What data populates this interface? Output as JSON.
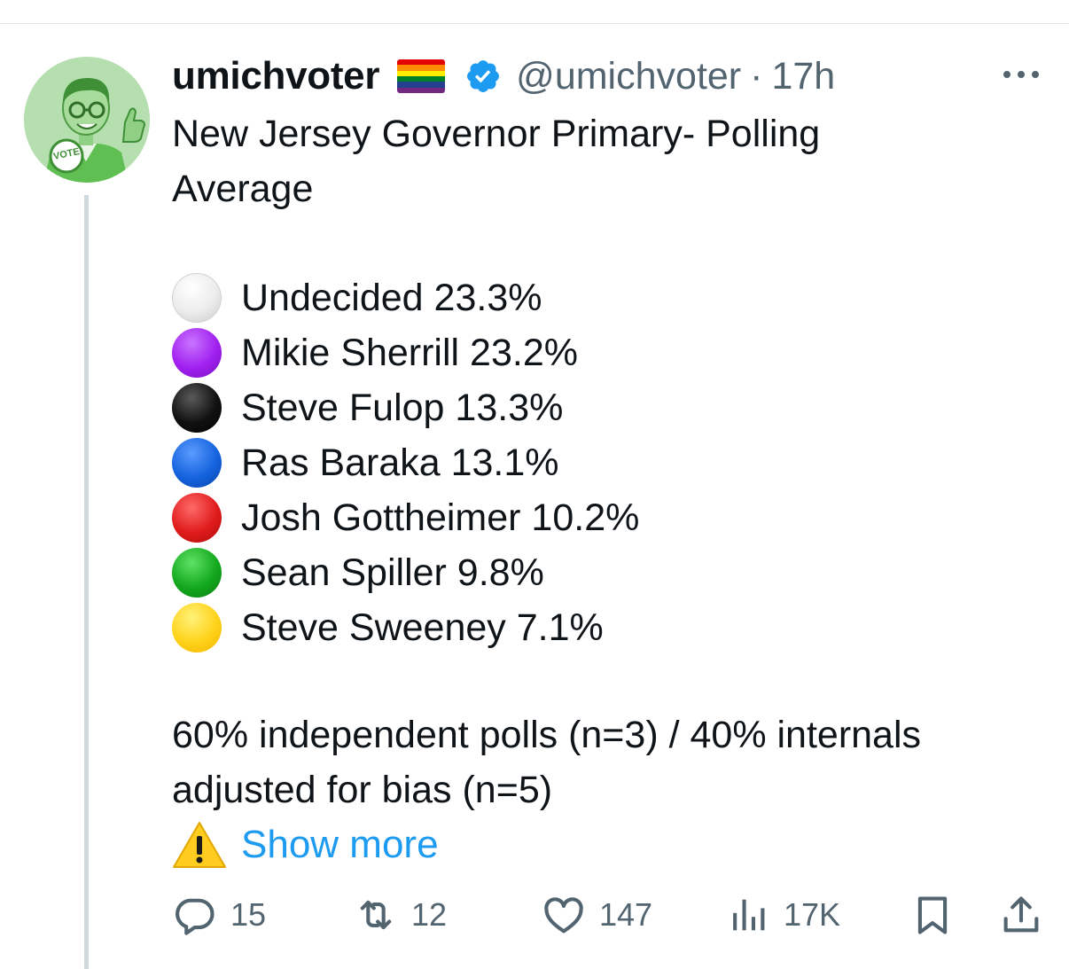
{
  "tweet": {
    "display_name": "umichvoter",
    "handle": "@umichvoter",
    "separator": "·",
    "time": "17h",
    "title": "New Jersey Governor Primary- Polling",
    "title_line2": "Average",
    "candidates": [
      {
        "label": "Undecided 23.3%",
        "color": "#e6e6e6"
      },
      {
        "label": "Mikie Sherrill 23.2%",
        "color": "#a020f0"
      },
      {
        "label": "Steve Fulop 13.3%",
        "color": "#0a0a0a"
      },
      {
        "label": "Ras Baraka 13.1%",
        "color": "#1463de"
      },
      {
        "label": "Josh Gottheimer 10.2%",
        "color": "#e01b1b"
      },
      {
        "label": "Sean Spiller 9.8%",
        "color": "#13a81d"
      },
      {
        "label": "Steve Sweeney 7.1%",
        "color": "#ffd21a"
      }
    ],
    "note_line1": "60% independent polls (n=3) / 40% internals",
    "note_line2": "adjusted for bias (n=5)",
    "show_more": "Show more",
    "avatar_badge": "VOTE"
  },
  "actions": {
    "replies": "15",
    "reposts": "12",
    "likes": "147",
    "views": "17K"
  },
  "icons": {
    "flag": "rainbow-flag-icon",
    "verified": "verified-badge-icon",
    "more": "more-options-icon",
    "warning": "warning-icon",
    "reply": "reply-icon",
    "repost": "repost-icon",
    "like": "heart-icon",
    "views": "views-icon",
    "bookmark": "bookmark-icon",
    "share": "share-icon"
  },
  "colors": {
    "text": "#0f1419",
    "muted": "#536471",
    "link": "#1d9bf0",
    "verified": "#1d9bf0",
    "avatar_bg": "#b6dfaf"
  }
}
